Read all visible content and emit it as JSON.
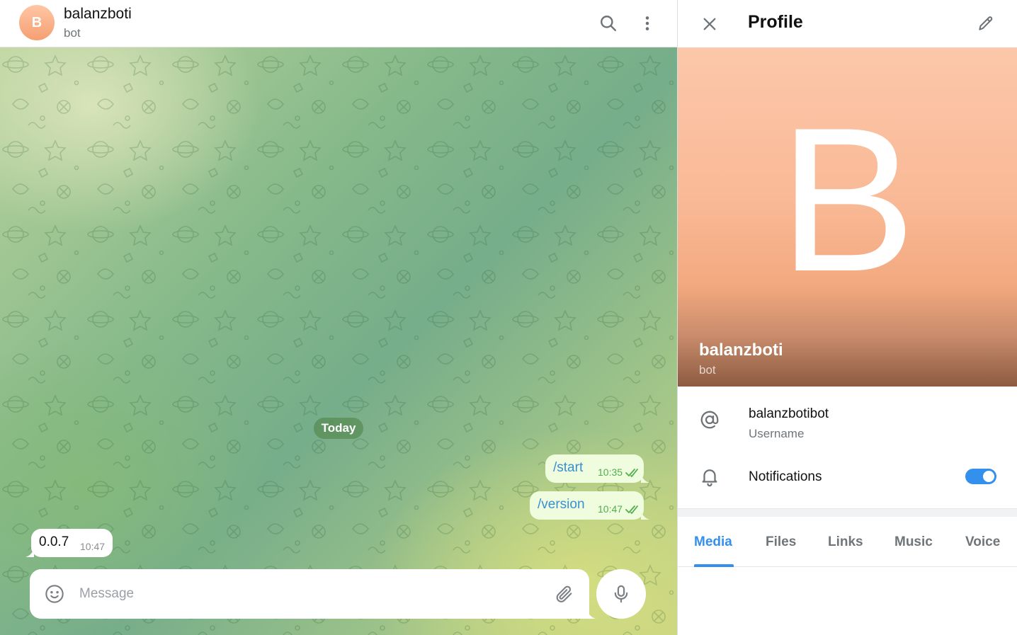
{
  "chat": {
    "avatar_letter": "B",
    "title": "balanzboti",
    "subtitle": "bot",
    "date_label": "Today",
    "messages": [
      {
        "direction": "out",
        "text": "/start",
        "time": "10:35"
      },
      {
        "direction": "out",
        "text": "/version",
        "time": "10:47"
      },
      {
        "direction": "in",
        "text": "0.0.7",
        "time": "10:47"
      }
    ],
    "composer": {
      "placeholder": "Message"
    }
  },
  "profile": {
    "title": "Profile",
    "avatar_letter": "B",
    "name": "balanzboti",
    "subtitle": "bot",
    "username": {
      "value": "balanzbotibot",
      "label": "Username"
    },
    "notifications": {
      "label": "Notifications",
      "enabled": true
    },
    "tabs": [
      "Media",
      "Files",
      "Links",
      "Music",
      "Voice"
    ],
    "active_tab": "Media"
  },
  "colors": {
    "accent": "#3390ec",
    "outgoing_bubble": "#effdde",
    "read_check": "#4fae4e"
  },
  "icons": [
    "search-icon",
    "more-vertical-icon",
    "close-icon",
    "pencil-icon",
    "at-sign-icon",
    "bell-icon",
    "smile-icon",
    "paperclip-icon",
    "microphone-icon",
    "double-check-icon"
  ]
}
